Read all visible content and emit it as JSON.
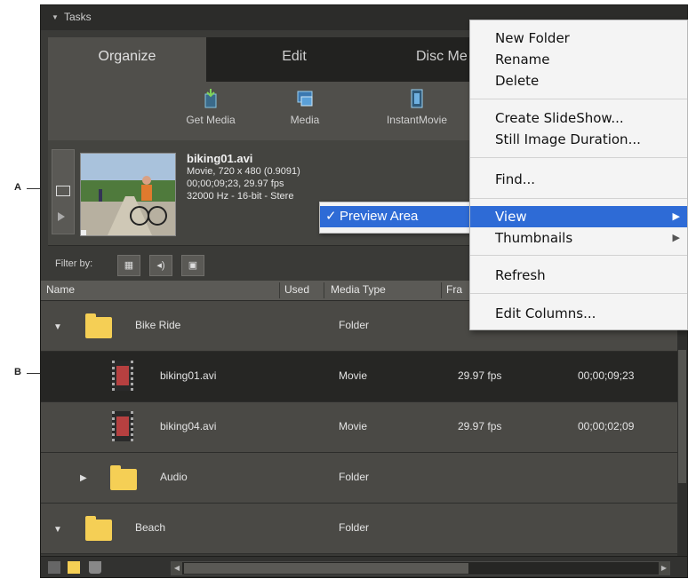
{
  "callouts": {
    "a": "A",
    "b": "B"
  },
  "panel": {
    "title": "Tasks",
    "tabs": [
      "Organize",
      "Edit",
      "Disc Me"
    ],
    "toolbar": {
      "get_media": "Get Media",
      "media": "Media",
      "instant_movie": "InstantMovie"
    },
    "preview": {
      "filename": "biking01.avi",
      "line1": "Movie, 720 x 480 (0.9091)",
      "line2": "00;00;09;23, 29.97 fps",
      "line3": "32000 Hz - 16-bit - Stere"
    },
    "filter_label": "Filter by:",
    "columns": {
      "name": "Name",
      "used": "Used",
      "media_type": "Media Type",
      "frame_rate": "Fra"
    },
    "rows": [
      {
        "name": "Bike Ride",
        "type": "Folder",
        "fps": "",
        "duration": "",
        "kind": "folder",
        "expanded": true,
        "level": 0,
        "selected": false
      },
      {
        "name": "biking01.avi",
        "type": "Movie",
        "fps": "29.97 fps",
        "duration": "00;00;09;23",
        "kind": "movie",
        "level": 1,
        "selected": true
      },
      {
        "name": "biking04.avi",
        "type": "Movie",
        "fps": "29.97 fps",
        "duration": "00;00;02;09",
        "kind": "movie",
        "level": 1,
        "selected": false
      },
      {
        "name": "Audio",
        "type": "Folder",
        "fps": "",
        "duration": "",
        "kind": "folder",
        "expanded": false,
        "level": 1,
        "selected": false
      },
      {
        "name": "Beach",
        "type": "Folder",
        "fps": "",
        "duration": "",
        "kind": "folder",
        "expanded": true,
        "level": 0,
        "selected": false
      }
    ]
  },
  "preview_area_menu": {
    "check": "✓",
    "label": "Preview Area"
  },
  "context_menu": {
    "new_folder": "New Folder",
    "rename": "Rename",
    "delete": "Delete",
    "create_slideshow": "Create SlideShow...",
    "still_image_duration": "Still Image Duration...",
    "find": "Find...",
    "view": "View",
    "thumbnails": "Thumbnails",
    "refresh": "Refresh",
    "edit_columns": "Edit Columns...",
    "submenu_arrow": "▶"
  },
  "colors": {
    "highlight": "#2e6bd6",
    "panel_bg": "#3a3a37",
    "selected_row": "#262624",
    "folder": "#f5cf55"
  }
}
